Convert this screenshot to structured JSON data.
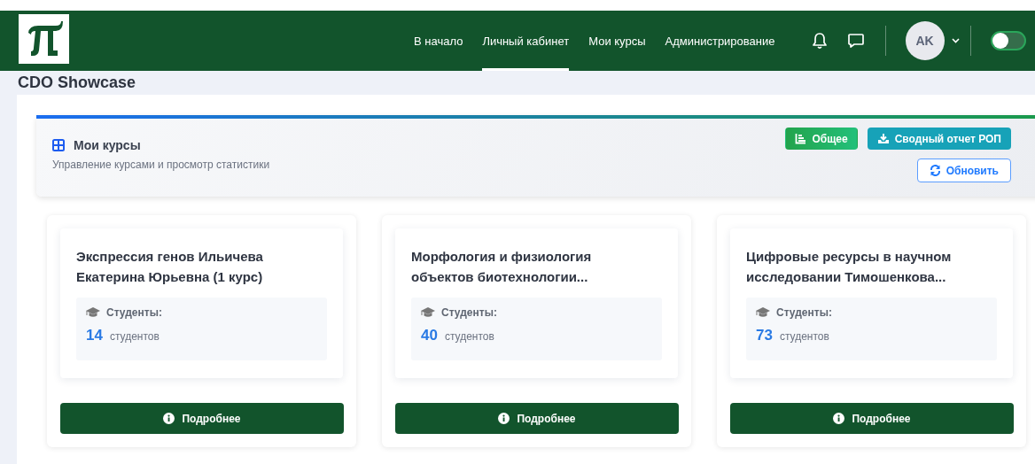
{
  "navbar": {
    "links": [
      {
        "label": "В начало",
        "selected": false
      },
      {
        "label": "Личный кабинет",
        "selected": true
      },
      {
        "label": "Мои курсы",
        "selected": false
      },
      {
        "label": "Администрирование",
        "selected": false
      }
    ],
    "avatar": "AK",
    "dark_mode": {
      "on": false
    }
  },
  "site_title": "CDO Showcase",
  "header": {
    "title": "Мои курсы",
    "subtitle": "Управление курсами и просмотр статистики",
    "buttons": [
      {
        "label": "Общее",
        "kind": "general"
      },
      {
        "label": "Сводный отчет РОП",
        "kind": "report"
      },
      {
        "label": "Обновить",
        "kind": "refresh"
      }
    ]
  },
  "courses": [
    {
      "title": "Экспрессия генов Ильичева Екатерина Юрьевна (1 курс)",
      "students_label": "Студенты:",
      "count": "14",
      "unit": "студентов",
      "button": "Подробнее"
    },
    {
      "title": "Морфология и физиология объектов биотехнологии...",
      "students_label": "Студенты:",
      "count": "40",
      "unit": "студентов",
      "button": "Подробнее"
    },
    {
      "title": "Цифровые ресурсы в научном исследовании Тимошенкова...",
      "students_label": "Студенты:",
      "count": "73",
      "unit": "студентов",
      "button": "Подробнее"
    }
  ]
}
